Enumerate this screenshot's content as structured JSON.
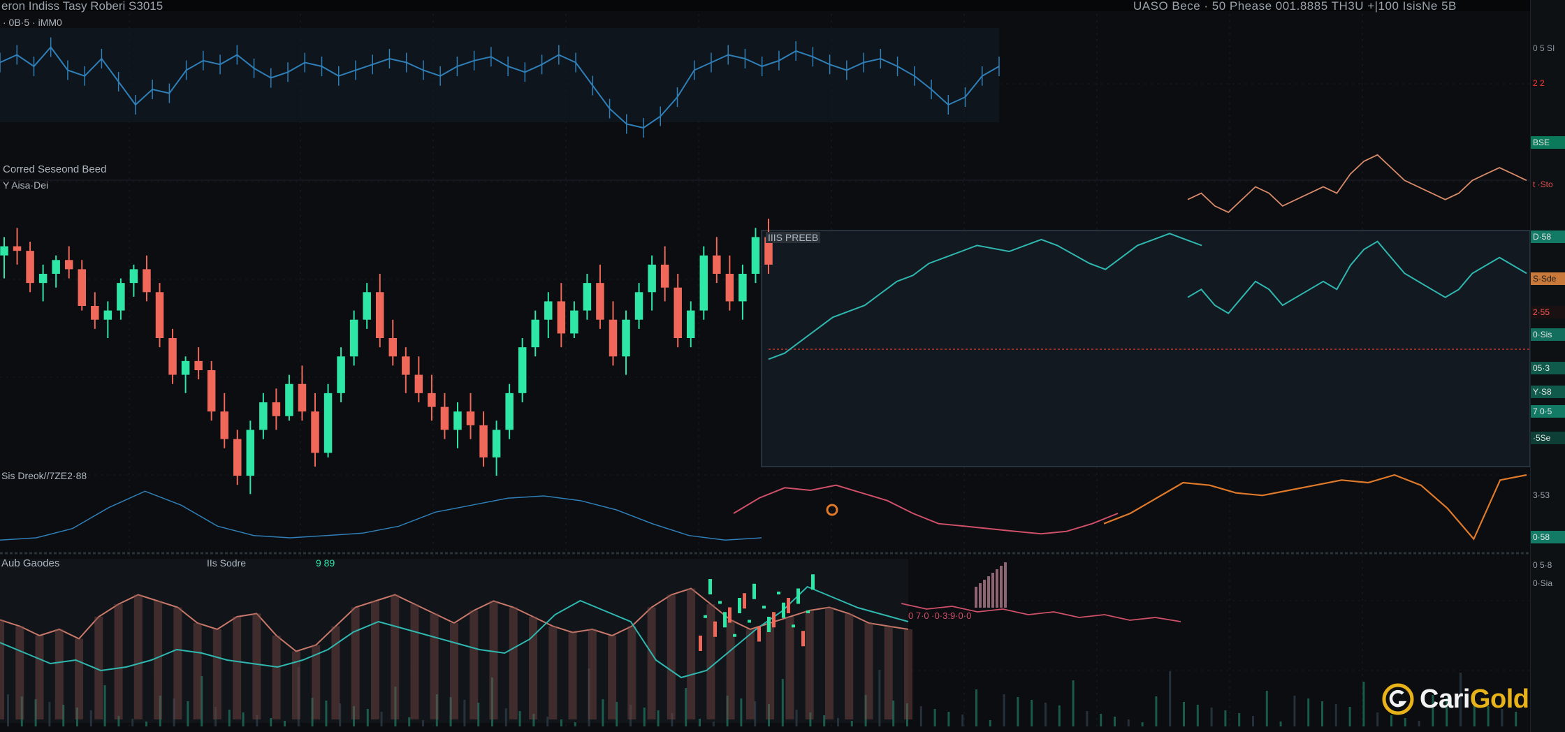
{
  "header": {
    "title": "eron Indiss Tasy Roberi S3015",
    "right_text": "UASO Bece · 50 Phease 001.8885 TH3U +|100 IsisNe 5B"
  },
  "panels": {
    "top_label": "· 0B·5 · iMM0",
    "mid_label": "Corred Seseond Beed",
    "mid_sublabel": "Y Aisa·Dei",
    "overlay_label": "IIIS PREEB",
    "osc_label": "Sis Dreok//7ZE2·88",
    "bottom_label_1": "Aub Gaodes",
    "bottom_label_2": "IIs Sodre",
    "bottom_label_3": "9 89",
    "bottom_note": "0 7·0 ·0·3:9·0·0",
    "osc_marker": "6"
  },
  "axis_tags": [
    {
      "text": "0 5 SI",
      "color": "#8a95a0",
      "bg": "transparent"
    },
    {
      "text": "2 2",
      "color": "#ff3b3b",
      "bg": "#0e1114"
    },
    {
      "text": "BSE",
      "color": "#e6e6e6",
      "bg": "#0b7a5a"
    },
    {
      "text": "t ·Sto",
      "color": "#e05050",
      "bg": "transparent"
    },
    {
      "text": "D·58",
      "color": "#e6e6e6",
      "bg": "#137a66"
    },
    {
      "text": "S·Sde",
      "color": "#1a1a1a",
      "bg": "#c97a3a"
    },
    {
      "text": "2·55",
      "color": "#ff5555",
      "bg": "#1a1212"
    },
    {
      "text": "0·Sis",
      "color": "#e6e6e6",
      "bg": "#146e5e"
    },
    {
      "text": "05·3",
      "color": "#e6e6e6",
      "bg": "#0f5a4a"
    },
    {
      "text": "Y·S8",
      "color": "#e6e6e6",
      "bg": "#0f5a4a"
    },
    {
      "text": "7 0·5",
      "color": "#e6e6e6",
      "bg": "#137a66"
    },
    {
      "text": "·5Se",
      "color": "#e6e6e6",
      "bg": "#0d3f36"
    },
    {
      "text": "3·53",
      "color": "#9aa3ad",
      "bg": "transparent"
    },
    {
      "text": "0·58",
      "color": "#e6e6e6",
      "bg": "#137a66"
    },
    {
      "text": "0 5·8",
      "color": "#9aa3ad",
      "bg": "transparent"
    },
    {
      "text": "0·Sia",
      "color": "#9aa3ad",
      "bg": "transparent"
    }
  ],
  "brand": {
    "name_part1": "Cari",
    "name_part2": "Gold",
    "color_white": "#f2f2f2",
    "color_gold": "#e8b21a"
  },
  "colors": {
    "up": "#2ee6a6",
    "down": "#f0685a",
    "blue": "#2f7fb8",
    "orange": "#e07a2a",
    "pink": "#d0506a",
    "teal": "#2fb8b0"
  },
  "chart_data": [
    {
      "type": "line",
      "title": "",
      "series": [
        {
          "values": [
            62,
            66,
            60,
            70,
            58,
            55,
            64,
            52,
            40,
            48,
            46,
            58,
            63,
            61,
            66,
            59,
            54,
            57,
            62,
            60,
            55,
            58,
            61,
            64,
            62,
            58,
            55,
            60,
            63,
            65,
            60,
            57,
            61,
            66,
            62,
            50,
            38,
            30,
            28,
            34,
            44,
            58,
            62,
            66,
            64,
            60,
            63,
            68,
            65,
            61,
            58,
            62,
            64,
            60,
            55,
            48,
            40,
            44,
            55,
            60
          ]
        }
      ]
    },
    {
      "type": "bar",
      "title": "",
      "series": [
        {
          "name": "OHLC",
          "values": [
            [
              60,
              64,
              55,
              62
            ],
            [
              62,
              66,
              58,
              61
            ],
            [
              61,
              63,
              52,
              54
            ],
            [
              54,
              58,
              50,
              56
            ],
            [
              56,
              60,
              53,
              59
            ],
            [
              59,
              62,
              55,
              57
            ],
            [
              57,
              59,
              48,
              49
            ],
            [
              49,
              52,
              44,
              46
            ],
            [
              46,
              50,
              42,
              48
            ],
            [
              48,
              55,
              46,
              54
            ],
            [
              54,
              58,
              51,
              57
            ],
            [
              57,
              60,
              50,
              52
            ],
            [
              52,
              54,
              40,
              42
            ],
            [
              42,
              44,
              32,
              34
            ],
            [
              34,
              38,
              30,
              37
            ],
            [
              37,
              40,
              33,
              35
            ],
            [
              35,
              37,
              24,
              26
            ],
            [
              26,
              30,
              18,
              20
            ],
            [
              20,
              22,
              10,
              12
            ],
            [
              12,
              24,
              8,
              22
            ],
            [
              22,
              30,
              20,
              28
            ],
            [
              28,
              31,
              22,
              25
            ],
            [
              25,
              34,
              24,
              32
            ],
            [
              32,
              36,
              24,
              26
            ],
            [
              26,
              30,
              14,
              17
            ],
            [
              17,
              32,
              16,
              30
            ],
            [
              30,
              40,
              28,
              38
            ],
            [
              38,
              48,
              36,
              46
            ],
            [
              46,
              54,
              44,
              52
            ],
            [
              52,
              56,
              40,
              42
            ],
            [
              42,
              46,
              36,
              38
            ],
            [
              38,
              40,
              30,
              34
            ],
            [
              34,
              38,
              28,
              30
            ],
            [
              30,
              34,
              24,
              27
            ],
            [
              27,
              30,
              20,
              22
            ],
            [
              22,
              28,
              18,
              26
            ],
            [
              26,
              30,
              20,
              23
            ],
            [
              23,
              26,
              14,
              16
            ],
            [
              16,
              24,
              12,
              22
            ],
            [
              22,
              32,
              20,
              30
            ],
            [
              30,
              42,
              28,
              40
            ],
            [
              40,
              48,
              38,
              46
            ],
            [
              46,
              52,
              42,
              50
            ],
            [
              50,
              54,
              40,
              43
            ],
            [
              43,
              50,
              42,
              48
            ],
            [
              48,
              56,
              46,
              54
            ],
            [
              54,
              58,
              44,
              46
            ],
            [
              46,
              50,
              36,
              38
            ],
            [
              38,
              48,
              34,
              46
            ],
            [
              46,
              54,
              44,
              52
            ],
            [
              52,
              60,
              48,
              58
            ],
            [
              58,
              62,
              50,
              53
            ],
            [
              53,
              56,
              40,
              42
            ],
            [
              42,
              50,
              40,
              48
            ],
            [
              48,
              62,
              46,
              60
            ],
            [
              60,
              64,
              54,
              56
            ],
            [
              56,
              60,
              48,
              50
            ],
            [
              50,
              58,
              46,
              56
            ],
            [
              56,
              66,
              54,
              64
            ],
            [
              64,
              68,
              56,
              58
            ]
          ]
        }
      ],
      "overlay_series": [
        {
          "values": [
            20,
            22,
            26,
            30,
            34,
            36,
            38,
            42,
            46,
            48,
            52,
            54,
            56,
            58,
            57,
            56,
            58,
            60,
            58,
            55,
            52,
            50,
            54,
            58,
            60,
            62,
            60,
            58
          ]
        },
        {
          "values": [
            48,
            50,
            46,
            44,
            48,
            52,
            50,
            46,
            48,
            50,
            52,
            50,
            56,
            60,
            62,
            58,
            54,
            52,
            50,
            48,
            50,
            54,
            56,
            58,
            56,
            54
          ]
        }
      ]
    },
    {
      "type": "line",
      "title": "",
      "series": [
        {
          "values": [
            10,
            12,
            20,
            38,
            52,
            40,
            22,
            14,
            12,
            14,
            16,
            22,
            34,
            40,
            46,
            48,
            44,
            36,
            24,
            14,
            10,
            12
          ]
        },
        {
          "values": [
            30,
            42,
            50,
            48,
            52,
            46,
            40,
            30,
            22,
            20,
            18,
            16,
            14,
            16,
            22,
            30,
            42,
            54,
            52,
            46,
            44,
            48,
            52,
            56,
            54,
            60,
            52,
            34,
            10,
            56,
            60
          ]
        }
      ]
    },
    {
      "type": "area",
      "title": "",
      "series": [
        {
          "values": [
            50,
            46,
            40,
            44,
            38,
            52,
            60,
            66,
            62,
            58,
            48,
            44,
            52,
            54,
            40,
            30,
            34,
            46,
            58,
            62,
            66,
            60,
            54,
            48,
            56,
            62,
            58,
            52,
            46,
            42,
            44,
            40,
            46,
            58,
            66,
            70,
            60,
            50,
            44,
            48,
            52,
            56,
            58,
            54,
            48,
            46,
            44
          ]
        },
        {
          "values": [
            40,
            34,
            28,
            30,
            24,
            26,
            30,
            36,
            34,
            30,
            28,
            26,
            30,
            36,
            46,
            52,
            48,
            44,
            40,
            36,
            34,
            42,
            56,
            64,
            58,
            52,
            30,
            20,
            24,
            36,
            48,
            58,
            72,
            66,
            60,
            56,
            52
          ]
        }
      ]
    }
  ]
}
